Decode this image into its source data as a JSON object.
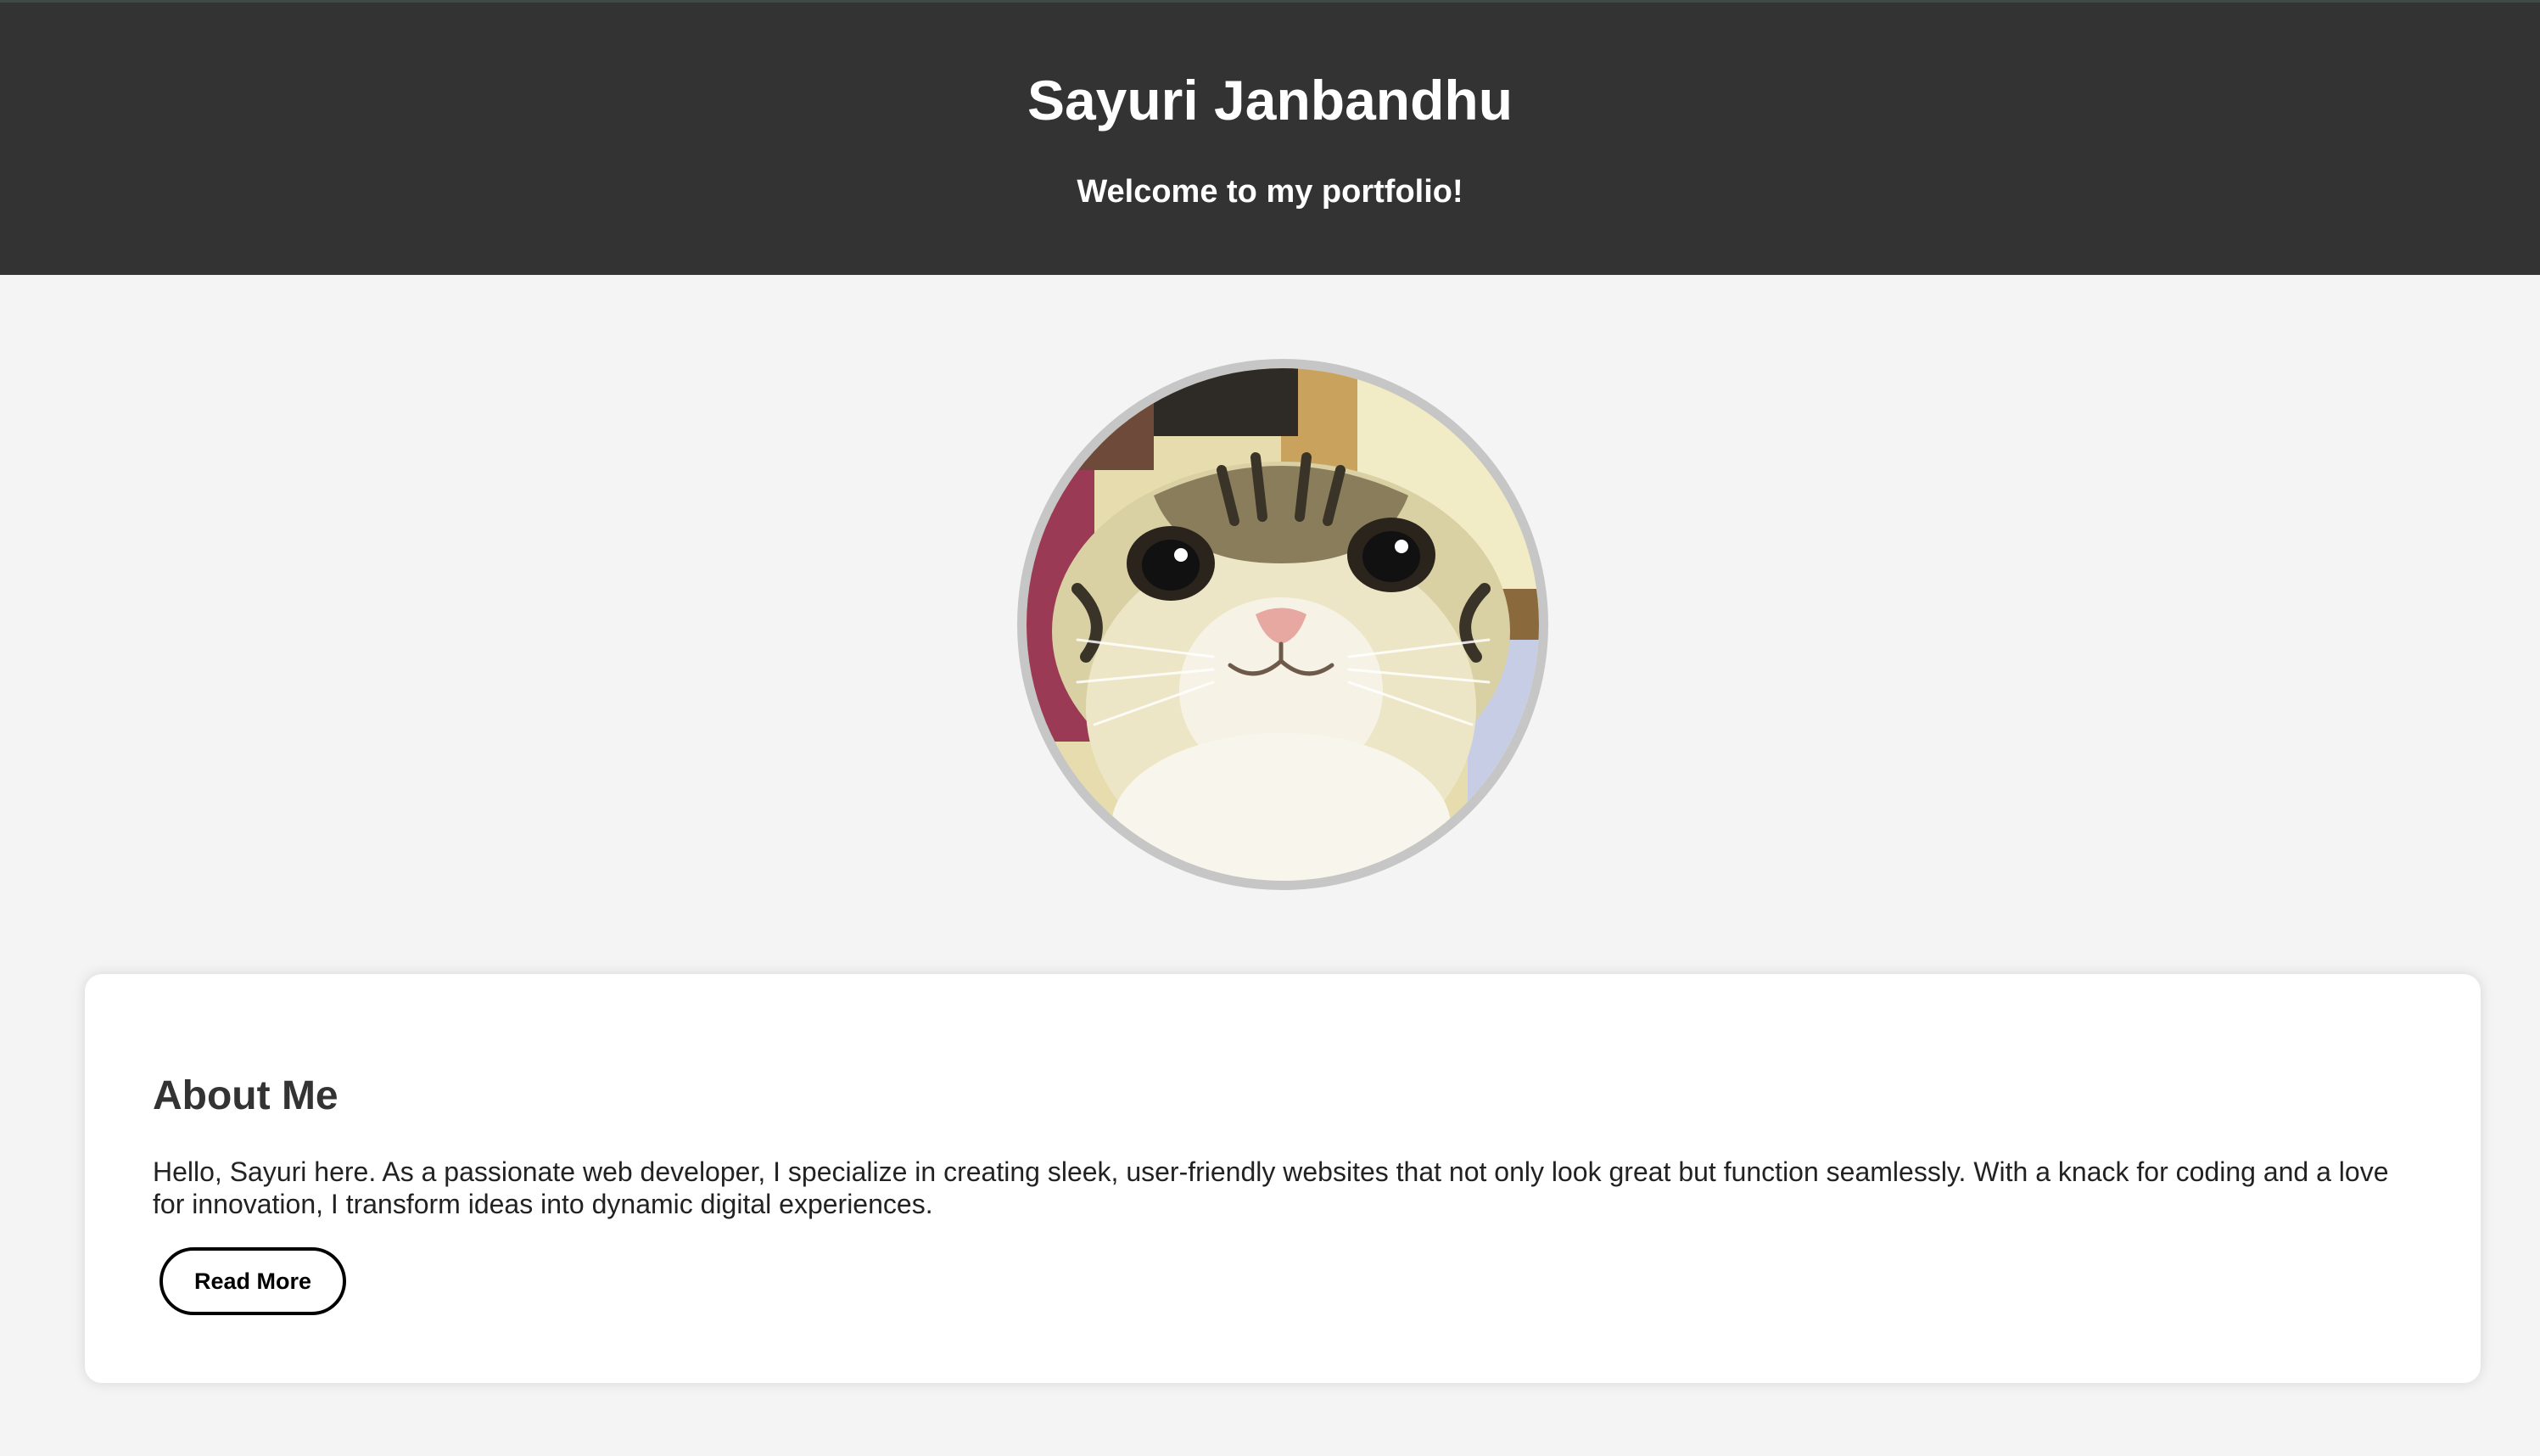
{
  "header": {
    "title": "Sayuri Janbandhu",
    "subtitle": "Welcome to my portfolio!"
  },
  "profile": {
    "image": "profile-photo"
  },
  "about": {
    "heading": "About Me",
    "text": "Hello, Sayuri here. As a passionate web developer, I specialize in creating sleek, user-friendly websites that not only look great but function seamlessly. With a knack for coding and a love for innovation, I transform ideas into dynamic digital experiences.",
    "button_label": "Read More"
  },
  "colors": {
    "header_bg": "#333333",
    "page_bg": "#f4f4f4",
    "card_bg": "#ffffff",
    "avatar_border": "#c6c6c6"
  }
}
